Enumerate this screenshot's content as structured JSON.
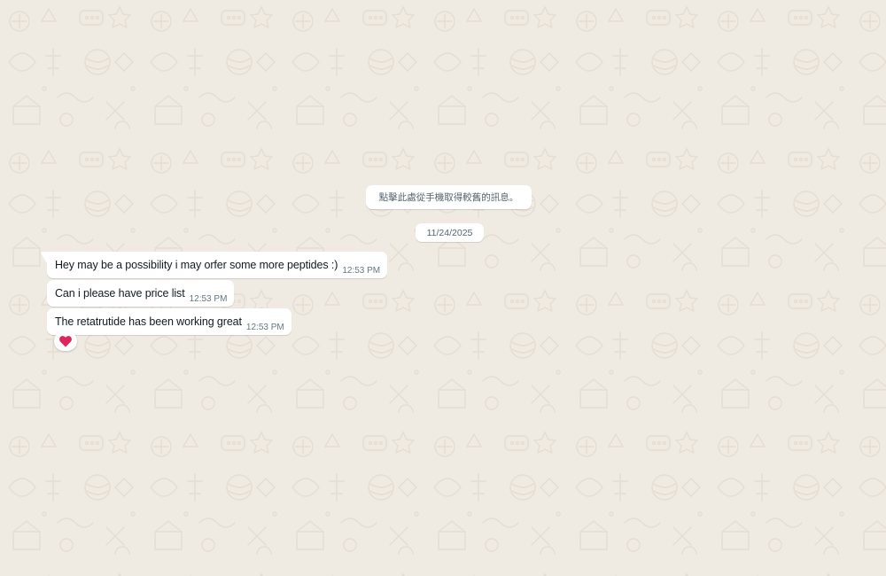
{
  "system_notice": {
    "text": "點擊此處從手機取得較舊的訊息。"
  },
  "date_separator": {
    "label": "11/24/2025"
  },
  "messages": [
    {
      "text": "Hey may be a possibility i may orfer some more peptides :)",
      "time": "12:53 PM"
    },
    {
      "text": "Can i please have price list",
      "time": "12:53 PM"
    },
    {
      "text": "The retatrutide has been working great",
      "time": "12:53 PM"
    }
  ],
  "reaction": {
    "emoji": "heart",
    "color": "#e0245e"
  },
  "colors": {
    "background": "#efeae2",
    "bubble": "#ffffff",
    "text": "#111b21",
    "meta": "#667781"
  }
}
